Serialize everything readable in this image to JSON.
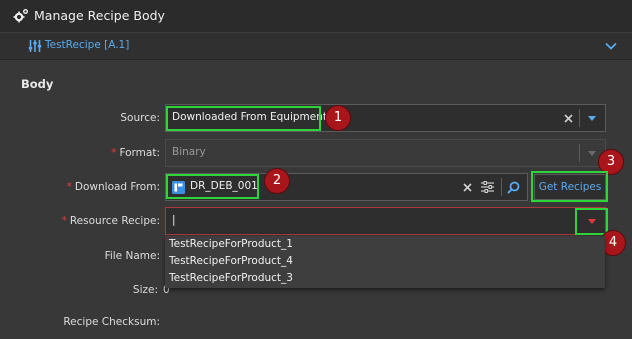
{
  "window": {
    "title": "Manage Recipe Body",
    "icon": "gear-icon"
  },
  "subheader": {
    "recipe_label": "TestRecipe [A.1]",
    "recipe_icon": "sliders-icon",
    "expand_icon": "chevron-down-icon"
  },
  "body": {
    "section_title": "Body",
    "source": {
      "label": "Source:",
      "value": "Downloaded From Equipment"
    },
    "format": {
      "label": "Format:",
      "value": "Binary"
    },
    "download_from": {
      "label": "Download From:",
      "value": "DR_DEB_001"
    },
    "get_recipes_label": "Get Recipes",
    "resource_recipe": {
      "label": "Resource Recipe:",
      "value": "|"
    },
    "file_name": {
      "label": "File Name:"
    },
    "size": {
      "label": "Size:",
      "value": "0"
    },
    "checksum": {
      "label": "Recipe Checksum:"
    }
  },
  "dropdown_options": [
    "TestRecipeForProduct_1",
    "TestRecipeForProduct_4",
    "TestRecipeForProduct_3"
  ],
  "annotations": [
    "1",
    "2",
    "3",
    "4"
  ],
  "colors": {
    "accent": "#5aaaf0",
    "highlight": "#2fd33a",
    "badge": "#a8151b",
    "required": "#e23b3b",
    "error_border": "#a83a3a"
  }
}
